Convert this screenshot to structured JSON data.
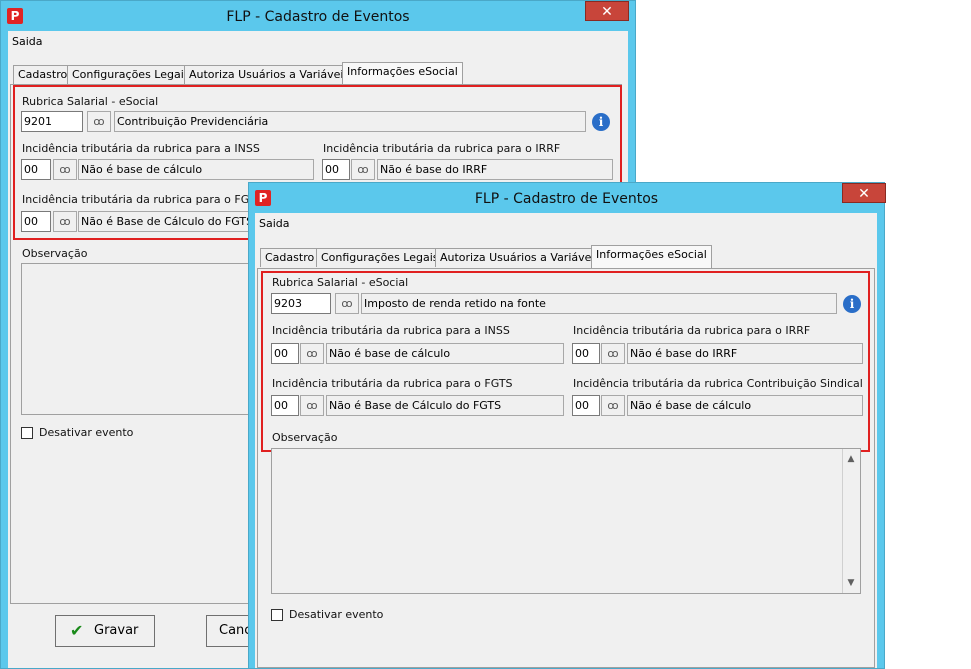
{
  "back": {
    "title": "FLP - Cadastro de Eventos",
    "icon_glyph": "P",
    "close_glyph": "✕",
    "menu": {
      "saida": "Saida"
    },
    "tabs": [
      "Cadastro",
      "Configurações Legais",
      "Autoriza Usuários a Variáveis",
      "Informações eSocial"
    ],
    "rubrica": {
      "label": "Rubrica Salarial - eSocial",
      "code": "9201",
      "description": "Contribuição Previdenciária"
    },
    "inss": {
      "label": "Incidência tributária da rubrica para a INSS",
      "code": "00",
      "description": "Não é base de cálculo"
    },
    "irrf": {
      "label": "Incidência tributária da rubrica para o IRRF",
      "code": "00",
      "description": "Não é base do IRRF"
    },
    "fgts": {
      "label": "Incidência tributária da rubrica para o FGTS",
      "code": "00",
      "description": "Não é Base de Cálculo do FGTS"
    },
    "observacao_label": "Observação",
    "desativar_label": "Desativar evento",
    "gravar_label": "Gravar",
    "cancel_label": "Canc"
  },
  "front": {
    "title": "FLP - Cadastro de Eventos",
    "icon_glyph": "P",
    "close_glyph": "✕",
    "menu": {
      "saida": "Saida"
    },
    "tabs": [
      "Cadastro",
      "Configurações Legais",
      "Autoriza Usuários a Variáveis",
      "Informações eSocial"
    ],
    "rubrica": {
      "label": "Rubrica Salarial - eSocial",
      "code": "9203",
      "description": "Imposto de renda retido na fonte"
    },
    "inss": {
      "label": "Incidência tributária da rubrica para a INSS",
      "code": "00",
      "description": "Não é base de cálculo"
    },
    "irrf": {
      "label": "Incidência tributária da rubrica para o IRRF",
      "code": "00",
      "description": "Não é base do IRRF"
    },
    "fgts": {
      "label": "Incidência tributária da rubrica para o FGTS",
      "code": "00",
      "description": "Não é Base de Cálculo do FGTS"
    },
    "sindical": {
      "label": "Incidência tributária da rubrica Contribuição Sindical",
      "code": "00",
      "description": "Não é base de cálculo"
    },
    "observacao_label": "Observação",
    "desativar_label": "Desativar evento"
  },
  "icons": {
    "binoculars": "ꝏ",
    "info": "i",
    "scroll_up": "▲",
    "scroll_down": "▼",
    "check": "✔"
  },
  "colors": {
    "titlebar": "#5bc8ec",
    "close": "#c8453a",
    "highlight": "#e02020"
  }
}
